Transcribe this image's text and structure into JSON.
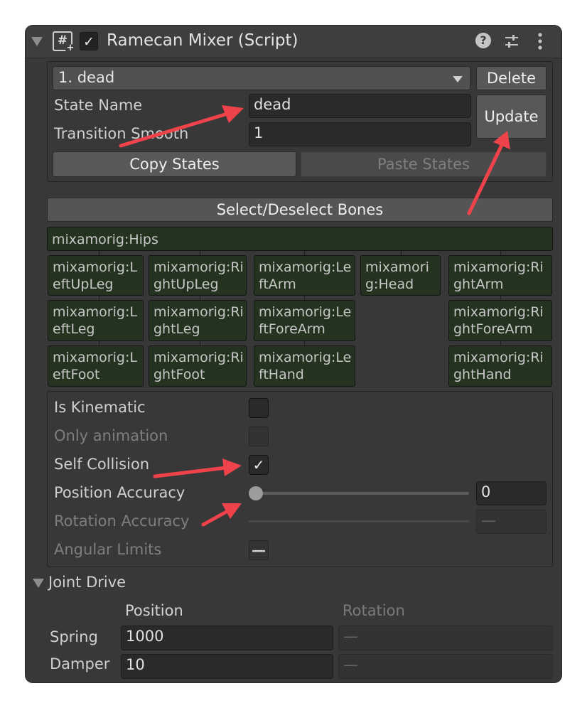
{
  "header": {
    "title": "Ramecan Mixer (Script)",
    "enabled_check": "✓",
    "script_icon": "#",
    "script_icon_plus": "+",
    "icons": [
      "chevron-down-icon",
      "script-icon",
      "help-icon",
      "sliders-icon",
      "more-vertical-icon"
    ]
  },
  "state_section": {
    "selected_state": "1. dead",
    "delete_label": "Delete",
    "update_label": "Update",
    "state_name_label": "State Name",
    "state_name_value": "dead",
    "transition_smooth_label": "Transition Smooth",
    "transition_smooth_value": "1",
    "copy_states_label": "Copy States",
    "paste_states_label": "Paste States"
  },
  "bones": {
    "select_button_label": "Select/Deselect Bones",
    "root": "mixamorig:Hips",
    "columns": [
      [
        "mixamorig:LeftUpLeg",
        "mixamorig:LeftLeg",
        "mixamorig:LeftFoot"
      ],
      [
        "mixamorig:RightUpLeg",
        "mixamorig:RightLeg",
        "mixamorig:RightFoot"
      ],
      [
        "mixamorig:LeftArm",
        "mixamorig:LeftForeArm",
        "mixamorig:LeftHand"
      ],
      [
        "mixamorig:Head"
      ],
      [
        "mixamorig:RightArm",
        "mixamorig:RightForeArm",
        "mixamorig:RightHand"
      ]
    ]
  },
  "physics": {
    "is_kinematic_label": "Is Kinematic",
    "is_kinematic": false,
    "only_animation_label": "Only animation",
    "only_animation": false,
    "self_collision_label": "Self Collision",
    "self_collision": true,
    "self_collision_check": "✓",
    "position_accuracy_label": "Position Accuracy",
    "position_accuracy_value": "0",
    "rotation_accuracy_label": "Rotation Accuracy",
    "rotation_accuracy_value": "—",
    "angular_limits_label": "Angular Limits",
    "angular_limits_mixed": "—"
  },
  "joint_drive": {
    "title": "Joint Drive",
    "position_header": "Position",
    "rotation_header": "Rotation",
    "spring_label": "Spring",
    "spring_position": "1000",
    "spring_rotation": "—",
    "damper_label": "Damper",
    "damper_position": "10",
    "damper_rotation": "—"
  },
  "colors": {
    "panel_bg": "#383838",
    "bone_bg": "#24331f",
    "annotation_arrow": "#f0424a"
  }
}
